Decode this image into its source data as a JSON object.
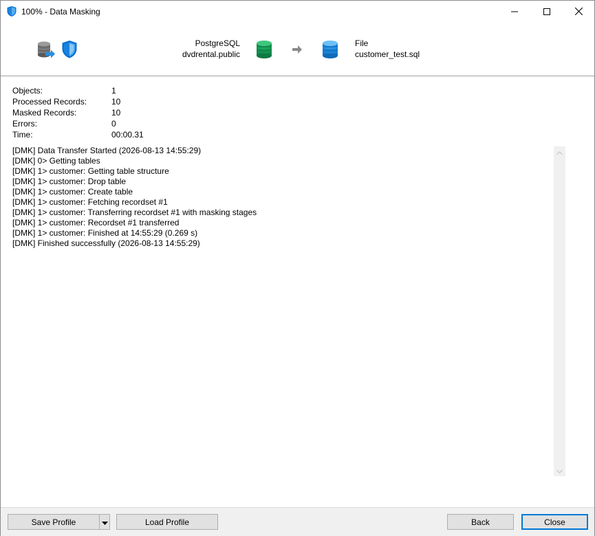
{
  "window": {
    "title": "100% - Data Masking",
    "icon": "shield-icon",
    "controls": [
      "minimize-icon",
      "maximize-icon",
      "close-icon"
    ]
  },
  "header": {
    "source": {
      "type": "PostgreSQL",
      "name": "dvdrental.public",
      "icon": "database-green-icon"
    },
    "destination": {
      "type": "File",
      "name": "customer_test.sql",
      "icon": "database-blue-icon"
    },
    "arrow_icon": "arrow-right-icon"
  },
  "stats": [
    {
      "label": "Objects:",
      "value": "1"
    },
    {
      "label": "Processed Records:",
      "value": "10"
    },
    {
      "label": "Masked Records:",
      "value": "10"
    },
    {
      "label": "Errors:",
      "value": "0"
    },
    {
      "label": "Time:",
      "value": "00:00.31"
    }
  ],
  "log": [
    "[DMK] Data Transfer Started (2026-08-13 14:55:29)",
    "[DMK] 0> Getting tables",
    "[DMK] 1> customer: Getting table structure",
    "[DMK] 1> customer: Drop table",
    "[DMK] 1> customer: Create table",
    "[DMK] 1> customer: Fetching recordset #1",
    "[DMK] 1> customer: Transferring recordset #1 with masking stages",
    "[DMK] 1> customer: Recordset #1 transferred",
    "[DMK] 1> customer: Finished at 14:55:29 (0.269 s)",
    "[DMK] Finished successfully (2026-08-13 14:55:29)"
  ],
  "footer": {
    "save_profile": "Save Profile",
    "load_profile": "Load Profile",
    "back": "Back",
    "close": "Close"
  },
  "colors": {
    "accent": "#0078d7",
    "green_db": "#1e9e5a",
    "blue_db": "#1a8ad8"
  }
}
